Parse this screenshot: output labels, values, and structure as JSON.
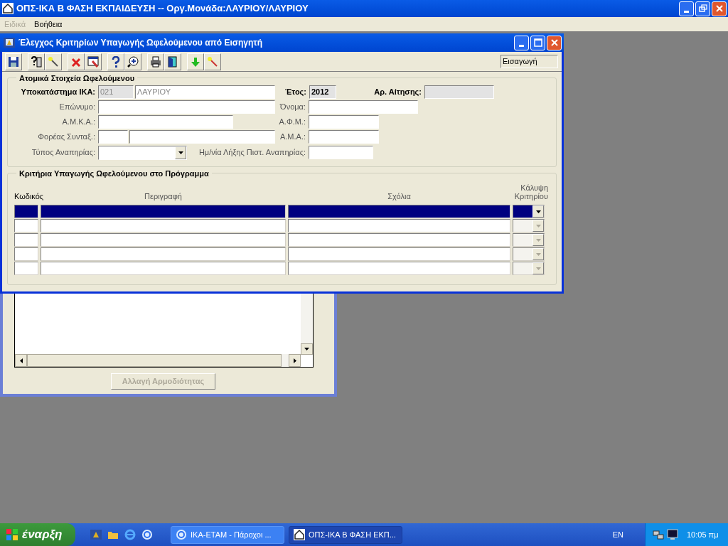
{
  "main_window": {
    "title": "ΟΠΣ-ΙΚΑ Β ΦΑΣΗ ΕΚΠΑΙΔΕΥΣΗ -- Οργ.Μονάδα:ΛΑΥΡΙΟΥ/ΛΑΥΡΙΟΥ",
    "menu": [
      {
        "label": "Ειδικά",
        "disabled": true
      },
      {
        "label": "Βοήθεια",
        "disabled": false
      }
    ]
  },
  "back_window": {
    "button": {
      "label": "Αλλαγή Αρμοδιότητας",
      "disabled": true
    }
  },
  "dialog": {
    "title": "Έλεγχος Κριτηρίων Υπαγωγής Ωφελούμενου από Εισηγητή",
    "mode": "Εισαγωγή",
    "personal": {
      "title": "Ατομικά Στοιχεία Ωφελούμενου",
      "branch_label": "Υποκατάστημα ΙΚΑ:",
      "branch_code": "021",
      "branch_name": "ΛΑΥΡΙΟΥ",
      "year_label": "Έτος:",
      "year": "2012",
      "application_label": "Αρ. Αίτησης:",
      "surname_label": "Επώνυμο:",
      "name_label": "Όνομα:",
      "amka_label": "Α.Μ.Κ.Α.:",
      "afm_label": "Α.Φ.Μ.:",
      "fund_label": "Φορέας Συνταξ.:",
      "ama_label": "Α.Μ.Α.:",
      "disability_label": "Τύπος Αναπηρίας:",
      "expiry_label": "Ημ/νία Λήξης Πιστ. Αναπηρίας:"
    },
    "criteria": {
      "title": "Κριτήρια Υπαγωγής Ωφελούμενου στο Πρόγραμμα",
      "columns": [
        "Κωδικός",
        "Περιγραφή",
        "Σχόλια",
        "Κάλυψη Κριτηρίου"
      ],
      "rows": [
        {
          "selected": true
        },
        {
          "selected": false
        },
        {
          "selected": false
        },
        {
          "selected": false
        },
        {
          "selected": false
        }
      ]
    }
  },
  "taskbar": {
    "start": "έναρξη",
    "tasks": [
      {
        "label": "ΙΚΑ-ΕΤΑΜ - Πάροχοι ...",
        "selected": false
      },
      {
        "label": "ΟΠΣ-ΙΚΑ Β ΦΑΣΗ ΕΚΠ...",
        "selected": true
      }
    ],
    "language": "EN",
    "clock": "10:05 πμ"
  }
}
